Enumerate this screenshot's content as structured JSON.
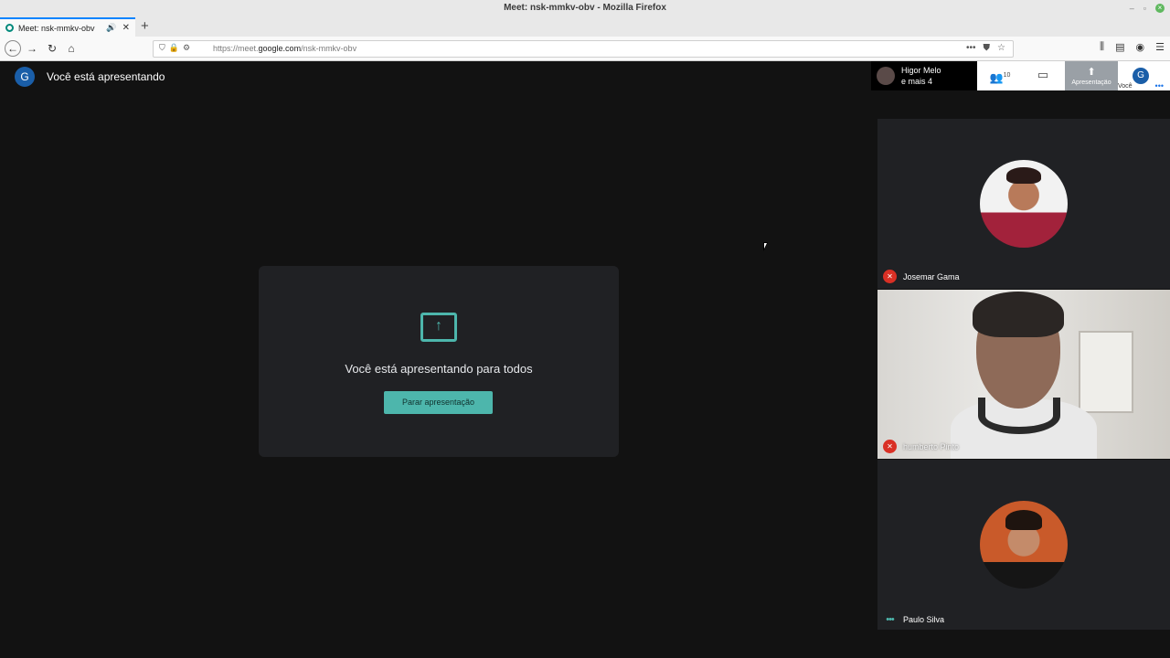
{
  "window": {
    "title": "Meet: nsk-mmkv-obv - Mozilla Firefox"
  },
  "browser": {
    "tab_title": "Meet: nsk-mmkv-obv",
    "url_prefix": "https://meet.",
    "url_domain": "google.com",
    "url_path": "/nsk-mmkv-obv"
  },
  "meet": {
    "avatar_letter": "G",
    "header_title": "Você está apresentando",
    "card_message": "Você está apresentando para todos",
    "stop_button": "Parar apresentação",
    "owner_name": "Higor Melo",
    "owner_more": "e mais 4",
    "people_count": "10",
    "present_label": "Apresentação",
    "you_label": "Você",
    "participants": [
      {
        "name": "Josemar Gama",
        "muted": true
      },
      {
        "name": "humberto Pinto",
        "muted": true
      },
      {
        "name": "Paulo Silva",
        "muted": false
      }
    ],
    "accent_color": "#4db6ac",
    "muted_color": "#d93025"
  }
}
